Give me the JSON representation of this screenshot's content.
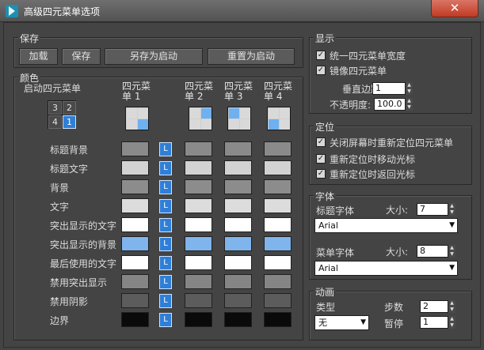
{
  "window": {
    "title": "高级四元菜单选项",
    "close": "✕"
  },
  "save": {
    "title": "保存",
    "buttons": [
      "加载",
      "保存",
      "另存为启动",
      "重置为启动"
    ]
  },
  "colors": {
    "title": "颜色",
    "start_quad_label": "启动四元菜单",
    "start_quad_cells": [
      "3",
      "2",
      "4",
      "1"
    ],
    "quad_headers": [
      [
        "四元菜",
        "单 1"
      ],
      [
        "四元菜",
        "单 2"
      ],
      [
        "四元菜",
        "单 3"
      ],
      [
        "四元菜",
        "单 4"
      ]
    ],
    "lock_label": "L",
    "rows": [
      {
        "label": "标题背景",
        "colors": [
          "#8a8a8a",
          "#8a8a8a",
          "#8a8a8a",
          "#8a8a8a"
        ]
      },
      {
        "label": "标题文字",
        "colors": [
          "#d2d2d2",
          "#d2d2d2",
          "#d2d2d2",
          "#d2d2d2"
        ]
      },
      {
        "label": "背景",
        "colors": [
          "#8c8c8c",
          "#8c8c8c",
          "#8c8c8c",
          "#8c8c8c"
        ]
      },
      {
        "label": "文字",
        "colors": [
          "#dcdcdc",
          "#dcdcdc",
          "#dcdcdc",
          "#dcdcdc"
        ]
      },
      {
        "label": "突出显示的文字",
        "colors": [
          "#ffffff",
          "#ffffff",
          "#ffffff",
          "#ffffff"
        ]
      },
      {
        "label": "突出显示的背景",
        "colors": [
          "#7fb4ec",
          "#7fb4ec",
          "#7fb4ec",
          "#7fb4ec"
        ]
      },
      {
        "label": "最后使用的文字",
        "colors": [
          "#ffffff",
          "#ffffff",
          "#ffffff",
          "#ffffff"
        ]
      },
      {
        "label": "禁用突出显示",
        "colors": [
          "#858585",
          "#858585",
          "#858585",
          "#858585"
        ]
      },
      {
        "label": "禁用阴影",
        "colors": [
          "#5c5c5c",
          "#5c5c5c",
          "#5c5c5c",
          "#5c5c5c"
        ]
      },
      {
        "label": "边界",
        "colors": [
          "#0a0a0a",
          "#0a0a0a",
          "#0a0a0a",
          "#0a0a0a"
        ]
      }
    ]
  },
  "display": {
    "title": "显示",
    "checkboxes": [
      {
        "label": "统一四元菜单宽度",
        "checked": true
      },
      {
        "label": "镜像四元菜单",
        "checked": true
      }
    ],
    "vertical_margin_label": "垂直边距",
    "vertical_margin_value": "1",
    "opacity_label": "不透明度:",
    "opacity_value": "100.0"
  },
  "positioning": {
    "title": "定位",
    "checkboxes": [
      {
        "label": "关闭屏幕时重新定位四元菜单",
        "checked": true
      },
      {
        "label": "重新定位时移动光标",
        "checked": true
      },
      {
        "label": "重新定位时返回光标",
        "checked": true
      }
    ]
  },
  "fonts": {
    "title": "字体",
    "title_font_label": "标题字体",
    "title_size_label": "大小:",
    "title_size_value": "7",
    "title_font_value": "Arial",
    "menu_font_label": "菜单字体",
    "menu_size_label": "大小:",
    "menu_size_value": "8",
    "menu_font_value": "Arial"
  },
  "animation": {
    "title": "动画",
    "type_label": "类型",
    "type_value": "无",
    "steps_label": "步数",
    "steps_value": "2",
    "pause_label": "暂停",
    "pause_value": "1"
  },
  "icons": {
    "app": "app-logo-icon",
    "checkbox": "checkmark-icon",
    "spinner": "spinner-arrows-icon",
    "dropdown": "chevron-down-icon"
  },
  "accent_color": "#2f7fd8",
  "highlight_color": "#6fb0f0"
}
